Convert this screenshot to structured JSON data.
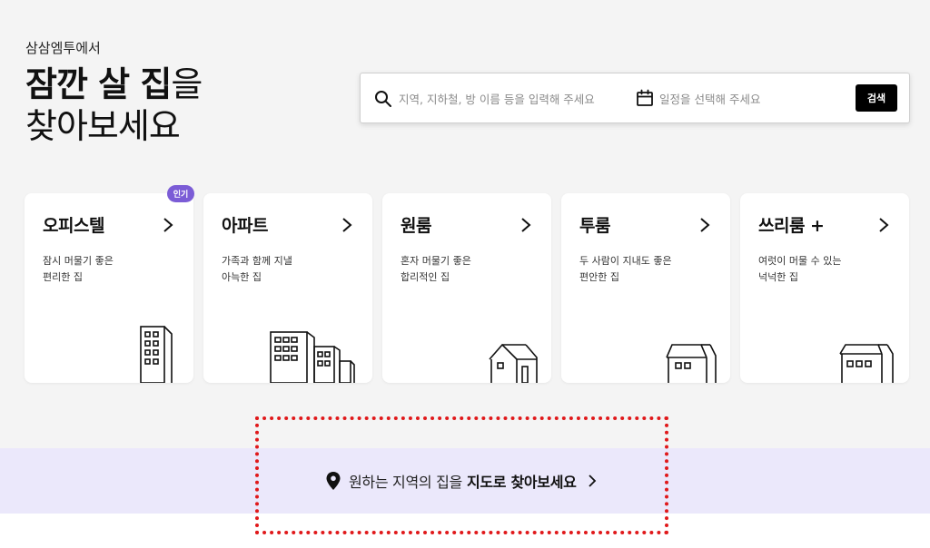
{
  "hero": {
    "subtitle": "삼삼엠투에서",
    "title_bold_1": "잠깐 살 집",
    "title_rest_1": "을",
    "title_line_2": "찾아보세요"
  },
  "search": {
    "location_placeholder": "지역, 지하철, 방 이름 등을 입력해 주세요",
    "date_placeholder": "일정을 선택해 주세요",
    "button_label": "검색"
  },
  "cards": [
    {
      "title": "오피스텔",
      "desc_1": "잠시 머물기 좋은",
      "desc_2": "편리한 집",
      "badge": "인기",
      "illustration": "office-tower-icon"
    },
    {
      "title": "아파트",
      "desc_1": "가족과 함께 지낼",
      "desc_2": "아늑한 집",
      "illustration": "apartment-buildings-icon"
    },
    {
      "title": "원룸",
      "desc_1": "혼자 머물기 좋은",
      "desc_2": "합리적인 집",
      "illustration": "small-house-icon"
    },
    {
      "title": "투룸",
      "desc_1": "두 사람이 지내도 좋은",
      "desc_2": "편안한 집",
      "illustration": "two-window-house-icon"
    },
    {
      "title": "쓰리룸 +",
      "desc_1": "여럿이 머물 수 있는",
      "desc_2": "넉넉한 집",
      "illustration": "three-window-house-icon"
    }
  ],
  "map_banner": {
    "text_regular": "원하는 지역의 집을",
    "text_bold": "지도로 찾아보세요"
  },
  "colors": {
    "background": "#f4f4f4",
    "banner": "#ebe8fb",
    "badge": "#7b5cd6",
    "button": "#000000",
    "highlight": "#e0191b"
  }
}
